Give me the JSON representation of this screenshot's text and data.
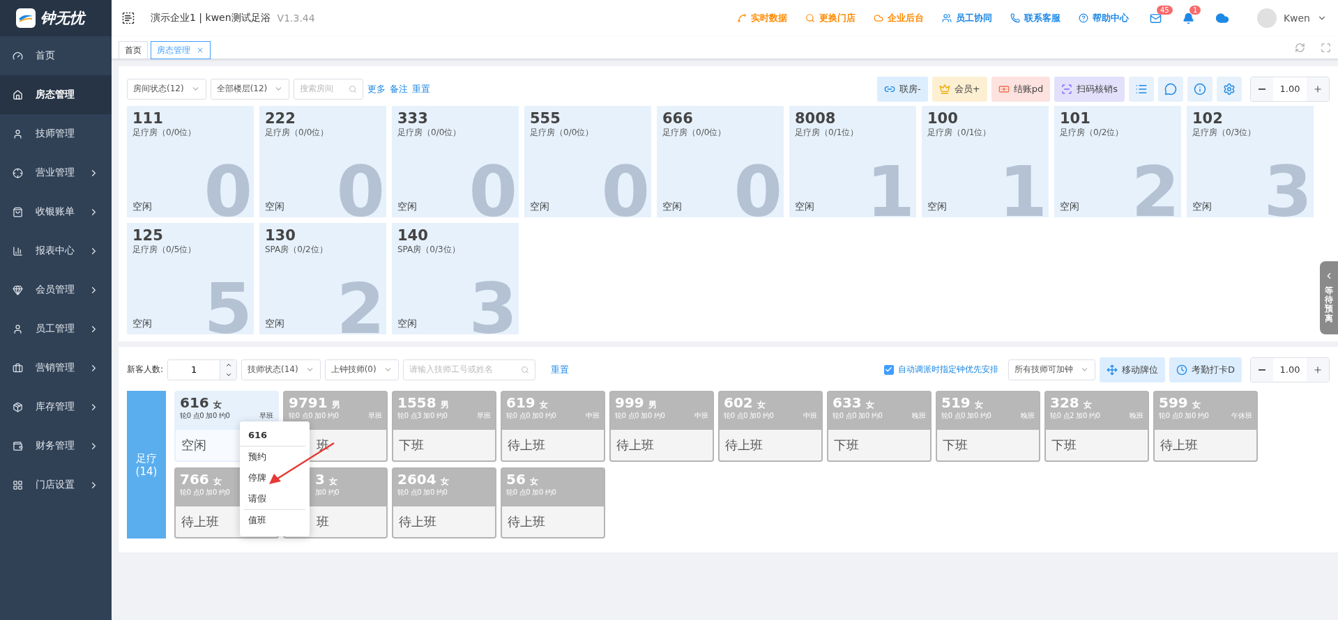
{
  "app": {
    "logo": "钟无忧",
    "company": "演示企业1 | kwen测试足浴",
    "version": "V1.3.44"
  },
  "top_links": [
    {
      "label": "实时数据",
      "color": "#ff8a00"
    },
    {
      "label": "更换门店",
      "color": "#ff8a00"
    },
    {
      "label": "企业后台",
      "color": "#ff8a00"
    },
    {
      "label": "员工协同",
      "color": "#1e88e5"
    },
    {
      "label": "联系客服",
      "color": "#1e88e5"
    },
    {
      "label": "帮助中心",
      "color": "#1e88e5"
    }
  ],
  "notifications": {
    "mail": "45",
    "bell": "1"
  },
  "user": {
    "name": "Kwen"
  },
  "sidebar": {
    "items": [
      {
        "label": "首页",
        "selected": false,
        "submenu": false
      },
      {
        "label": "房态管理",
        "selected": true,
        "submenu": false
      },
      {
        "label": "技师管理",
        "selected": false,
        "submenu": false
      },
      {
        "label": "营业管理",
        "selected": false,
        "submenu": true
      },
      {
        "label": "收银账单",
        "selected": false,
        "submenu": true
      },
      {
        "label": "报表中心",
        "selected": false,
        "submenu": true
      },
      {
        "label": "会员管理",
        "selected": false,
        "submenu": true
      },
      {
        "label": "员工管理",
        "selected": false,
        "submenu": true
      },
      {
        "label": "营销管理",
        "selected": false,
        "submenu": true
      },
      {
        "label": "库存管理",
        "selected": false,
        "submenu": true
      },
      {
        "label": "财务管理",
        "selected": false,
        "submenu": true
      },
      {
        "label": "门店设置",
        "selected": false,
        "submenu": true
      }
    ]
  },
  "tabs": [
    {
      "label": "首页",
      "selected": false,
      "closable": false
    },
    {
      "label": "房态管理",
      "selected": true,
      "closable": true
    }
  ],
  "room_toolbar": {
    "filters": [
      "房间状态(12)",
      "全部楼层(12)"
    ],
    "search_placeholder": "搜索房间",
    "links": [
      "更多",
      "备注",
      "重置"
    ],
    "buttons": [
      {
        "label": "联房-",
        "kind": "room"
      },
      {
        "label": "会员+",
        "kind": "member"
      },
      {
        "label": "结账pd",
        "kind": "checkout"
      },
      {
        "label": "扫码核销s",
        "kind": "scan"
      }
    ],
    "zoom": "1.00"
  },
  "rooms": [
    {
      "number": "111",
      "type": "足疗房（0/0位）",
      "status": "空闲",
      "count": "0"
    },
    {
      "number": "222",
      "type": "足疗房（0/0位）",
      "status": "空闲",
      "count": "0"
    },
    {
      "number": "333",
      "type": "足疗房（0/0位）",
      "status": "空闲",
      "count": "0"
    },
    {
      "number": "555",
      "type": "足疗房（0/0位）",
      "status": "空闲",
      "count": "0"
    },
    {
      "number": "666",
      "type": "足疗房（0/0位）",
      "status": "空闲",
      "count": "0"
    },
    {
      "number": "8008",
      "type": "足疗房（0/1位）",
      "status": "空闲",
      "count": "1"
    },
    {
      "number": "100",
      "type": "足疗房（0/1位）",
      "status": "空闲",
      "count": "1"
    },
    {
      "number": "101",
      "type": "足疗房（0/2位）",
      "status": "空闲",
      "count": "2"
    },
    {
      "number": "102",
      "type": "足疗房（0/3位）",
      "status": "空闲",
      "count": "3"
    },
    {
      "number": "125",
      "type": "足疗房（0/5位）",
      "status": "空闲",
      "count": "5"
    },
    {
      "number": "130",
      "type": "SPA房（0/2位）",
      "status": "空闲",
      "count": "2"
    },
    {
      "number": "140",
      "type": "SPA房（0/3位）",
      "status": "空闲",
      "count": "3"
    }
  ],
  "side_drawer": {
    "label": "等待预离"
  },
  "tech_toolbar": {
    "guest_label": "新客人数:",
    "guest_count": "1",
    "filters": [
      "技师状态(14)",
      "上钟技师(0)"
    ],
    "search_placeholder": "请输入技师工号或姓名",
    "reset": "重置",
    "auto_assign": {
      "label": "自动调派时指定钟优先安排",
      "checked": true
    },
    "overtime_filter": "所有技师可加钟",
    "buttons": [
      {
        "label": "移动牌位",
        "kind": "move"
      },
      {
        "label": "考勤打卡D",
        "kind": "clock"
      }
    ],
    "zoom": "1.00"
  },
  "category": {
    "name": "足疗",
    "count": "(14)"
  },
  "technicians": [
    {
      "number": "616",
      "gender": "女",
      "stats": "轮0 点0 加0 约0",
      "shift": "早班",
      "status": "空闲",
      "selected": true,
      "kind": "full"
    },
    {
      "number": "9791",
      "gender": "男",
      "stats": "轮0 点0 加0 约0",
      "shift": "早班",
      "status": "班",
      "selected": false,
      "kind": "status_hidden"
    },
    {
      "number": "1558",
      "gender": "男",
      "stats": "轮0 点3 加0 约0",
      "shift": "早班",
      "status": "下班",
      "selected": false,
      "kind": "full"
    },
    {
      "number": "619",
      "gender": "女",
      "stats": "轮0 点0 加0 约0",
      "shift": "中班",
      "status": "待上班",
      "selected": false,
      "kind": "full"
    },
    {
      "number": "999",
      "gender": "男",
      "stats": "轮0 点0 加0 约0",
      "shift": "中班",
      "status": "待上班",
      "selected": false,
      "kind": "full"
    },
    {
      "number": "602",
      "gender": "女",
      "stats": "轮0 点0 加0 约0",
      "shift": "中班",
      "status": "待上班",
      "selected": false,
      "kind": "full"
    },
    {
      "number": "633",
      "gender": "女",
      "stats": "轮0 点0 加0 约0",
      "shift": "晚班",
      "status": "下班",
      "selected": false,
      "kind": "full"
    },
    {
      "number": "519",
      "gender": "女",
      "stats": "轮0 点0 加0 约0",
      "shift": "晚班",
      "status": "下班",
      "selected": false,
      "kind": "full"
    },
    {
      "number": "328",
      "gender": "女",
      "stats": "轮0 点2 加0 约0",
      "shift": "晚班",
      "status": "下班",
      "selected": false,
      "kind": "full"
    },
    {
      "number": "599",
      "gender": "女",
      "stats": "轮0 点0 加0 约0",
      "shift": "午休班",
      "status": "待上班",
      "selected": false,
      "kind": "full"
    },
    {
      "number": "766",
      "gender": "女",
      "stats": "轮0 点0 加0 约0",
      "status": "待上班",
      "selected": false,
      "kind": "full"
    },
    {
      "number": "3",
      "gender": "女",
      "stats": "加0 约0",
      "status": "班",
      "selected": false,
      "kind": "partly_hidden"
    },
    {
      "number": "2604",
      "gender": "女",
      "stats": "轮0 点0 加0 约0",
      "status": "待上班",
      "selected": false,
      "kind": "full"
    },
    {
      "number": "56",
      "gender": "女",
      "stats": "轮0 点0 加0 约0",
      "status": "待上班",
      "selected": false,
      "kind": "full"
    }
  ],
  "context_menu": {
    "title": "616",
    "groups": [
      [
        "预约",
        "停牌",
        "请假"
      ],
      [
        "值班"
      ]
    ]
  }
}
